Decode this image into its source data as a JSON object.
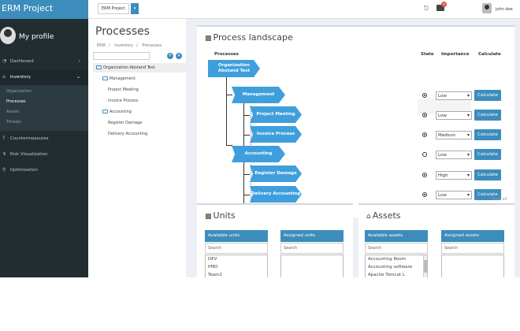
{
  "app": {
    "title": "ERM Project"
  },
  "topbar": {
    "project_label": "ERM Project",
    "mail_count": "9",
    "user_name": "john doe"
  },
  "sidebar": {
    "profile_title": "My profile",
    "items": [
      {
        "label": "Dashboard"
      },
      {
        "label": "Inventory"
      },
      {
        "label": "Countermeasures"
      },
      {
        "label": "Risk Visualization"
      },
      {
        "label": "Optimization"
      }
    ],
    "subitems": [
      {
        "label": "Organization"
      },
      {
        "label": "Processes"
      },
      {
        "label": "Assets"
      },
      {
        "label": "Threats"
      }
    ]
  },
  "tree": {
    "title": "Processes",
    "breadcrumb": [
      "ERM",
      "Inventory",
      "Processes"
    ],
    "root": "Organization Abstand Test",
    "nodes": [
      "Management",
      "Project Meeting",
      "Invoice Process",
      "Accounting",
      "Register Damage",
      "Delivery Accounting"
    ]
  },
  "landscape": {
    "title": "Process landscape",
    "headers": {
      "processes": "Processes",
      "state": "State",
      "importance": "Importance",
      "calculate": "Calculate"
    },
    "root_label": "Organization Abstand Test",
    "rows": [
      {
        "label": "Management",
        "importance": "Low",
        "calc": "Calculate"
      },
      {
        "label": "Project Meeting",
        "importance": "Low",
        "calc": "Calculate"
      },
      {
        "label": "Invoice Process",
        "importance": "Medium",
        "calc": "Calculate"
      },
      {
        "label": "Accounting",
        "importance": "Low",
        "calc": "Calculate"
      },
      {
        "label": "Register Damage",
        "importance": "High",
        "calc": "Calculate"
      },
      {
        "label": "Delivery Accounting",
        "importance": "Low",
        "calc": "Calculate"
      }
    ],
    "view_all": "View all"
  },
  "units": {
    "title": "Units",
    "available_header": "Available units",
    "assigned_header": "Assigned units",
    "search_placeholder": "Search",
    "assigned_search_placeholder": "Search",
    "available_items": [
      "DEV",
      "PMO",
      "Team2"
    ]
  },
  "assets": {
    "title": "Assets",
    "available_header": "Available assets",
    "assigned_header": "Assigned assets",
    "search_placeholder": "Search",
    "assigned_search_placeholder": "Search",
    "available_items": [
      "Accounting Room",
      "Accounting software",
      "Apache Tomcat L"
    ]
  }
}
